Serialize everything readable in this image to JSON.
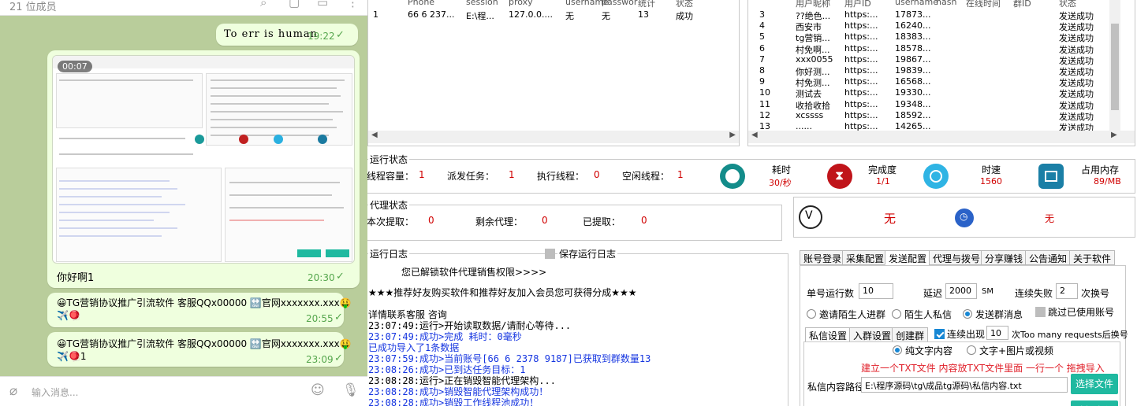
{
  "chat": {
    "member_count": "21 位成员",
    "input_placeholder": "输入消息...",
    "messages": [
      {
        "text": "To err is human",
        "time": "19:22"
      },
      {
        "video_duration": "00:07",
        "caption": "你好啊1",
        "time": "20:30"
      },
      {
        "text": "😀TG营销协议推广引流软件 客服QQx00000 🔛官网xxxxxxx.xxx🤑",
        "text2": "✈️🪀",
        "time": "20:55"
      },
      {
        "text": "😀TG营销协议推广引流软件 客服QQx00000 🔛官网xxxxxxx.xxx🤑",
        "text2": "✈️🪀1",
        "time": "23:09"
      }
    ]
  },
  "accounts_table": {
    "columns": [
      "Phone",
      "session",
      "proxy",
      "username",
      "passwor",
      "统计",
      "状态"
    ],
    "rows": [
      [
        "1",
        "66 6 237...",
        "E:\\程...",
        "127.0.0....",
        "无",
        "无",
        "13",
        "成功"
      ]
    ]
  },
  "users_table": {
    "columns": [
      "用户昵称",
      "用户ID",
      "username",
      "hash",
      "在线时间",
      "群ID",
      "状态"
    ],
    "rows": [
      [
        "3",
        "??绝色...",
        "https:...",
        "17873...",
        "发送成功"
      ],
      [
        "4",
        "西安市",
        "https:...",
        "16240...",
        "发送成功"
      ],
      [
        "5",
        "tg营销...",
        "https:...",
        "18383...",
        "发送成功"
      ],
      [
        "6",
        "村免啊...",
        "https:...",
        "18578...",
        "发送成功"
      ],
      [
        "7",
        "xxx0055",
        "https:...",
        "19867...",
        "发送成功"
      ],
      [
        "8",
        "你好测...",
        "https:...",
        "19839...",
        "发送成功"
      ],
      [
        "9",
        "村免测...",
        "https:...",
        "16568...",
        "发送成功"
      ],
      [
        "10",
        "测试去",
        "https:...",
        "19330...",
        "发送成功"
      ],
      [
        "11",
        "收拾收拾",
        "https:...",
        "19348...",
        "发送成功"
      ],
      [
        "12",
        "xcssss",
        "https:...",
        "18592...",
        "发送成功"
      ],
      [
        "13",
        "......",
        "https:...",
        "14265...",
        "发送成功"
      ]
    ]
  },
  "run_status": {
    "title": "运行状态",
    "thread_capacity_label": "线程容量：",
    "thread_capacity": "1",
    "dispatch_label": "派发任务：",
    "dispatch": "1",
    "exec_label": "执行线程：",
    "exec": "0",
    "idle_label": "空闲线程：",
    "idle": "1",
    "elapsed_label": "耗时",
    "elapsed": "30/秒",
    "completion_label": "完成度",
    "completion": "1/1",
    "speed_label": "时速",
    "speed": "1560",
    "memory_label": "占用内存",
    "memory": "89/MB"
  },
  "proxy_status": {
    "title": "代理状态",
    "fetched_label": "本次提取：",
    "fetched": "0",
    "remaining_label": "剩余代理：",
    "remaining": "0",
    "extracted_label": "已提取：",
    "extracted": "0",
    "status1": "无",
    "status2": "无"
  },
  "log": {
    "title": "运行日志",
    "save_label": "保存运行日志",
    "lines": [
      {
        "text": "您已解锁软件代理销售权限>>>>",
        "color": "k"
      },
      {
        "text": "★★★推荐好友购买软件和推荐好友加入会员您可获得分成★★★",
        "color": "k"
      },
      {
        "text": "详情联系客服  咨询",
        "color": "k"
      },
      {
        "text": "23:07:49:运行>开始读取数据/请耐心等待...",
        "color": "k"
      },
      {
        "text": "23:07:49:成功>完成 耗时：0毫秒",
        "color": "b"
      },
      {
        "text": "已成功导入了1条数据",
        "color": "b"
      },
      {
        "text": "23:07:59:成功>当前账号[66 6 2378 9187]已获取到群数量13",
        "color": "b"
      },
      {
        "text": "23:08:26:成功>已到达任务目标：1",
        "color": "b"
      },
      {
        "text": "23:08:28:运行>正在销毁智能代理架构...",
        "color": "k"
      },
      {
        "text": "23:08:28:成功>销毁智能代理架构成功！",
        "color": "b"
      },
      {
        "text": "23:08:28:成功>销毁工作线程池成功！",
        "color": "b"
      }
    ]
  },
  "tabs": [
    "账号登录",
    "采集配置",
    "发送配置",
    "代理与拨号",
    "分享赚钱",
    "公告通知",
    "关于软件"
  ],
  "send_config": {
    "accounts_run_label": "单号运行数",
    "accounts_run": "10",
    "delay_label": "延迟",
    "delay": "2000",
    "delay_unit": "SM",
    "fail_label": "连续失败",
    "fail": "2",
    "fail_unit": "次换号",
    "radio1": "邀请陌生人进群",
    "radio2": "陌生人私信",
    "radio3": "发送群消息",
    "skip_used": "跳过已使用账号",
    "subtabs": [
      "私信设置",
      "入群设置",
      "创建群"
    ],
    "continuous_label": "连续出现",
    "continuous": "10",
    "continuous_tail": "次Too many requests后换号",
    "pure_text": "纯文字内容",
    "text_media": "文字+图片或视频",
    "hint": "建立一个TXT文件 内容放TXT文件里面 一行一个 拖拽导入",
    "path_label": "私信内容路径",
    "path": "E:\\程序源码\\tg\\成品tg源码\\私信内容.txt",
    "choose_file": "选择文件"
  }
}
